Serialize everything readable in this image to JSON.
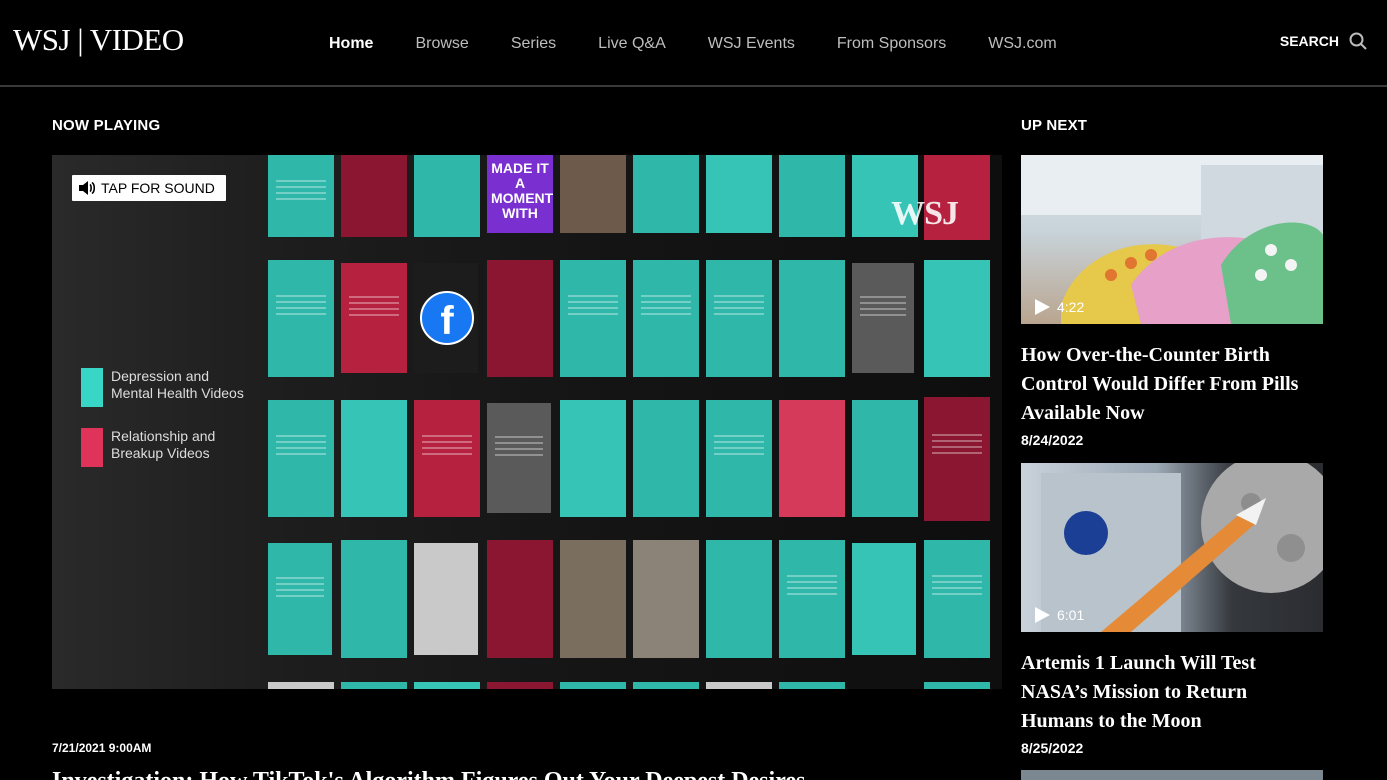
{
  "header": {
    "logo": "WSJ | VIDEO",
    "nav": [
      "Home",
      "Browse",
      "Series",
      "Live Q&A",
      "WSJ Events",
      "From Sponsors",
      "WSJ.com"
    ],
    "search_label": "SEARCH"
  },
  "now_playing": {
    "section_title": "NOW PLAYING",
    "sound_button": "TAP FOR SOUND",
    "watermark": "WSJ",
    "legend": [
      {
        "label": "Depression and Mental Health Videos",
        "color": "#37d6c7"
      },
      {
        "label": "Relationship and Breakup Videos",
        "color": "#e0335a"
      }
    ],
    "tile_texts": {
      "moment": "MADE IT A MOMENT WITH"
    },
    "date": "7/21/2021 9:00AM",
    "headline": "Investigation: How TikTok's Algorithm Figures Out Your Deepest Desires"
  },
  "up_next": {
    "section_title": "UP NEXT",
    "cards": [
      {
        "duration": "4:22",
        "title": "How Over-the-Counter Birth Control Would Differ From Pills Available Now",
        "date": "8/24/2022"
      },
      {
        "duration": "6:01",
        "title": "Artemis 1 Launch Will Test NASA’s Mission to Return Humans to the Moon",
        "date": "8/25/2022"
      }
    ]
  },
  "colors": {
    "accent_teal": "#2fb7aa",
    "accent_red": "#b5213f",
    "facebook_blue": "#1877f2"
  },
  "icons": [
    "speaker-icon",
    "search-icon",
    "play-icon",
    "facebook-icon"
  ]
}
